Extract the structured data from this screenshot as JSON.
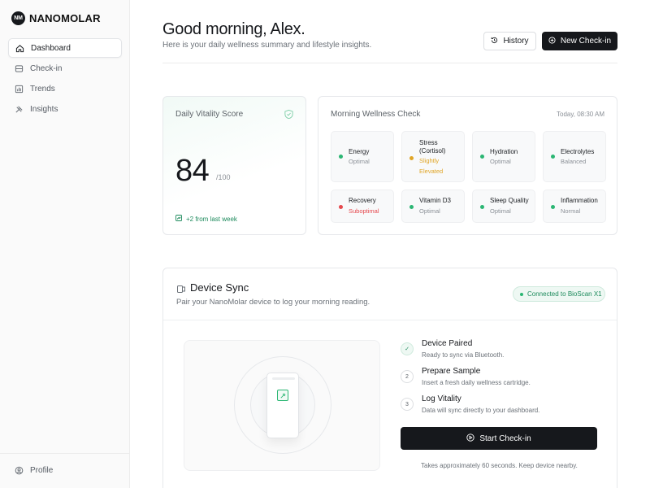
{
  "brand": {
    "mark": "NM",
    "name": "NANOMOLAR"
  },
  "sidebar": {
    "items": [
      {
        "label": "Dashboard",
        "icon": "home-icon"
      },
      {
        "label": "Check-in",
        "icon": "cartridge-icon"
      },
      {
        "label": "Trends",
        "icon": "chart-icon"
      },
      {
        "label": "Insights",
        "icon": "sparkle-icon"
      }
    ],
    "active_index": 0,
    "profile_label": "Profile"
  },
  "header": {
    "title": "Good morning, Alex.",
    "subtitle": "Here is your daily wellness summary and lifestyle insights.",
    "history_label": "History",
    "new_checkin_label": "New Check-in"
  },
  "vitality": {
    "title": "Daily Vitality Score",
    "score": "84",
    "max": "/100",
    "trend": "+2 from last week"
  },
  "wellness": {
    "title": "Morning Wellness Check",
    "timestamp": "Today, 08:30 AM",
    "metrics": [
      {
        "name": "Energy",
        "status": "Optimal",
        "level": "optimal"
      },
      {
        "name": "Stress (Cortisol)",
        "status": "Slightly Elevated",
        "level": "warning"
      },
      {
        "name": "Hydration",
        "status": "Optimal",
        "level": "optimal"
      },
      {
        "name": "Electrolytes",
        "status": "Balanced",
        "level": "optimal"
      },
      {
        "name": "Recovery",
        "status": "Suboptimal",
        "level": "alert"
      },
      {
        "name": "Vitamin D3",
        "status": "Optimal",
        "level": "optimal"
      },
      {
        "name": "Sleep Quality",
        "status": "Optimal",
        "level": "optimal"
      },
      {
        "name": "Inflammation",
        "status": "Normal",
        "level": "optimal"
      }
    ]
  },
  "sync": {
    "title": "Device Sync",
    "subtitle": "Pair your NanoMolar device to log your morning reading.",
    "badge": "Connected to BioScan X1",
    "steps": [
      {
        "marker": "✓",
        "title": "Device Paired",
        "desc": "Ready to sync via Bluetooth."
      },
      {
        "marker": "2",
        "title": "Prepare Sample",
        "desc": "Insert a fresh daily wellness cartridge."
      },
      {
        "marker": "3",
        "title": "Log Vitality",
        "desc": "Data will sync directly to your dashboard."
      }
    ],
    "start_label": "Start Check-in",
    "note": "Takes approximately 60 seconds. Keep device nearby."
  },
  "colors": {
    "optimal": "#2bb673",
    "warning": "#e0a526",
    "alert": "#e5484d",
    "dark": "#16181c"
  }
}
